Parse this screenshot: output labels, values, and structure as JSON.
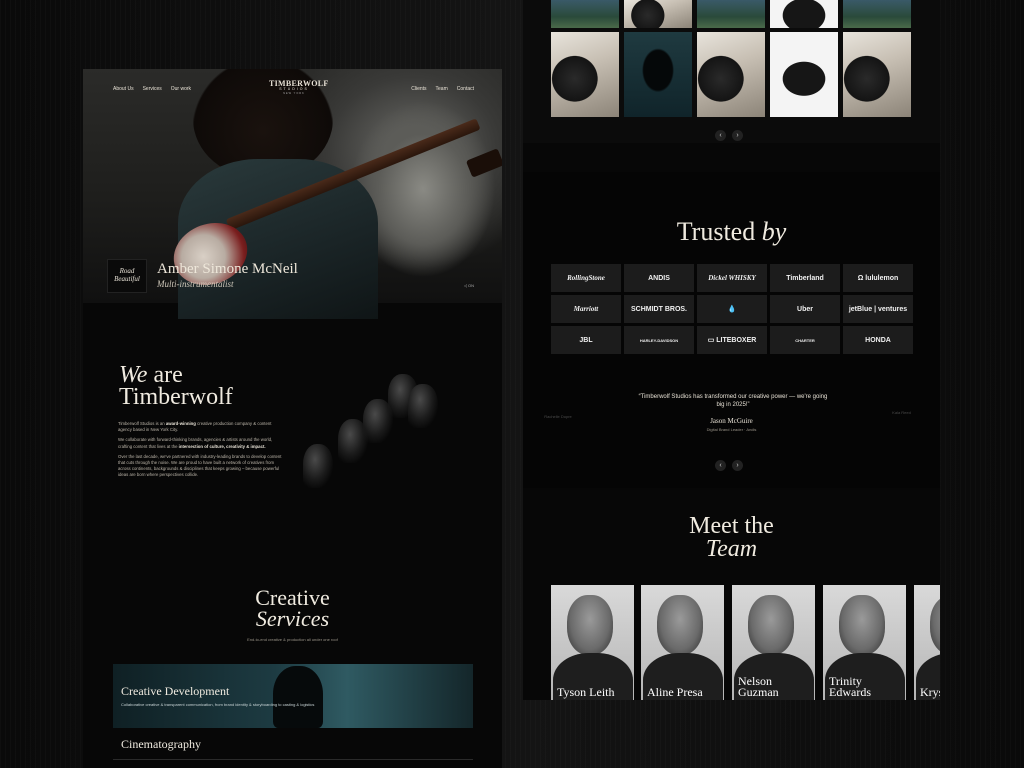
{
  "left": {
    "nav_left": [
      "About Us",
      "Services",
      "Our work"
    ],
    "nav_right": [
      "Clients",
      "Team",
      "Contact"
    ],
    "logo": {
      "line1": "TIMBERWOLF",
      "line2": "STUDIOS",
      "line3": "NEW YORK"
    },
    "hero": {
      "badge": "Road Beautiful",
      "name": "Amber Simone McNeil",
      "role": "Multi-instrumentalist",
      "volume": "◁ ON"
    },
    "about": {
      "title_italic": "We",
      "title_rest_1": "are",
      "title_line2": "Timberwolf",
      "p1_a": "Timberwolf Studios is an ",
      "p1_b": "award-winning",
      "p1_c": " creative production company & content agency based in New York City.",
      "p2_a": "We collaborate with forward-thinking brands, agencies & artists around the world, crafting content that lives at the ",
      "p2_b": "intersection of culture, creativity & impact.",
      "p3": "Over the last decade, we've partnered with industry-leading brands to develop content that cuts through the noise. We are proud to have built a network of creatives from across continents, backgrounds & disciplines that keeps growing – because powerful ideas are born where perspectives collide."
    },
    "services": {
      "title_line1": "Creative",
      "title_line2": "Services",
      "subtitle": "End-to-end creative & production all under one roof",
      "card_title": "Creative Development",
      "card_desc": "Collaborative creative & transparent communication, from brand identity & storyboarding to casting & logistics",
      "second": "Cinematography"
    }
  },
  "right": {
    "arrows": [
      "‹",
      "›"
    ],
    "trusted": {
      "title_main": "Trusted",
      "title_italic": "by"
    },
    "logos": [
      "RollingStone",
      "ANDIS",
      "Dickel WHISKY",
      "Timberland",
      "Ω lululemon",
      "Marriott",
      "SCHMIDT BROS.",
      "💧",
      "Uber",
      "jetBlue | ventures",
      "JBL",
      "HARLEY-DAVIDSON",
      "▭ LITEBOXER",
      "CHARTER",
      "HONDA"
    ],
    "quote": {
      "text": "“Timberwolf Studios has transformed our creative power — we're going big in 2025!”",
      "name": "Jason McGuire",
      "role": "Digital Brand Leader · Andis",
      "side_left_name": "Rachelle Dupre",
      "side_right_name": "Kala Reed"
    },
    "team": {
      "title_line1": "Meet the",
      "title_line2": "Team",
      "members": [
        "Tyson Leith",
        "Aline Presa",
        "Nelson Guzman",
        "Trinity Edwards",
        "Krys Torn"
      ]
    }
  }
}
